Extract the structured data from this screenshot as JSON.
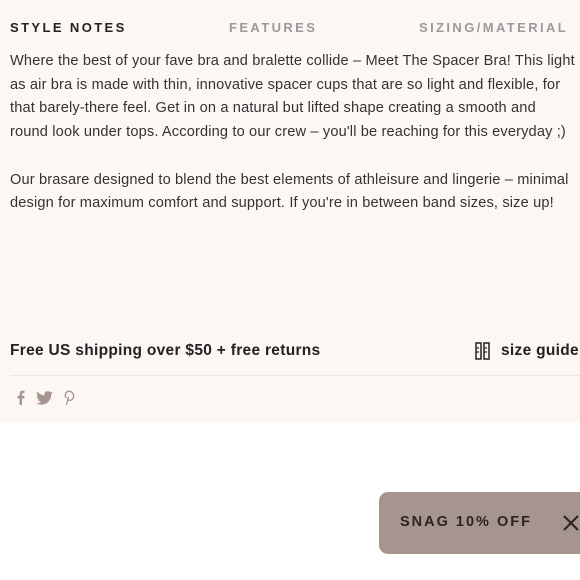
{
  "tabs": [
    {
      "label": "STYLE NOTES",
      "active": true
    },
    {
      "label": "FEATURES",
      "active": false
    },
    {
      "label": "SIZING/MATERIAL",
      "active": false
    }
  ],
  "description": {
    "paragraph1": "Where the best of your fave bra and bralette collide – Meet The Spacer Bra! This light as air bra is made with thin, innovative spacer cups that are so light and flexible, for that barely-there feel. Get in on a natural but lifted shape creating a smooth and round look under tops. According to our crew – you'll be reaching for this everyday ;)",
    "paragraph2": "Our brasare designed to blend the best elements of athleisure and lingerie – minimal design for maximum comfort and support. If you're in between band sizes, size up!"
  },
  "shipping": {
    "text": "Free US shipping over $50 + free returns",
    "size_guide_label": "size guide",
    "size_guide_icon": "ruler-icon"
  },
  "social": {
    "icons": [
      "facebook-icon",
      "twitter-icon",
      "pinterest-icon"
    ],
    "color": "#a6948f"
  },
  "popup": {
    "label": "SNAG 10% OFF",
    "close_icon": "close-icon",
    "background": "#a6948f"
  },
  "colors": {
    "panel_background": "#fcf7f4",
    "active_tab": "#222222",
    "inactive_tab": "#9a9a9a"
  }
}
